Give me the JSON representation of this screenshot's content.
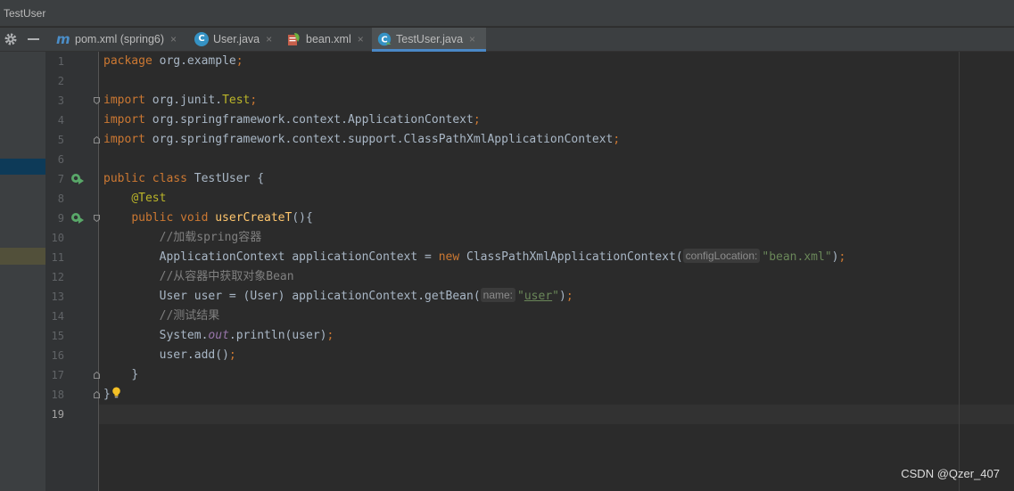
{
  "window": {
    "title": "TestUser"
  },
  "tabs": [
    {
      "label": "pom.xml (spring6)",
      "icon": "maven-m-icon",
      "active": false
    },
    {
      "label": "User.java",
      "icon": "java-class-icon",
      "active": false
    },
    {
      "label": "bean.xml",
      "icon": "spring-xml-icon",
      "active": false
    },
    {
      "label": "TestUser.java",
      "icon": "java-test-class-icon",
      "active": true
    }
  ],
  "tab_close_glyph": "×",
  "toolbar": {
    "settings_icon": "gear-icon",
    "hide_icon": "minus-icon"
  },
  "editor": {
    "line_numbers": [
      "1",
      "2",
      "3",
      "4",
      "5",
      "6",
      "7",
      "8",
      "9",
      "10",
      "11",
      "12",
      "13",
      "14",
      "15",
      "16",
      "17",
      "18",
      "19"
    ],
    "current_line": "19",
    "code": {
      "l1": {
        "kw": "package",
        "rest": " org.example",
        "semi": ";"
      },
      "l3": {
        "kw": "import",
        "pkg": " org.junit.",
        "cls": "Test",
        "semi": ";"
      },
      "l4": {
        "kw": "import",
        "rest": " org.springframework.context.ApplicationContext",
        "semi": ";"
      },
      "l5": {
        "kw": "import",
        "rest": " org.springframework.context.support.ClassPathXmlApplicationContext",
        "semi": ";"
      },
      "l7": {
        "kw": "public class",
        "rest": " TestUser {"
      },
      "l8": {
        "ann": "@Test"
      },
      "l9": {
        "kw": "public void",
        "fn": "userCreateT",
        "rest": "(){"
      },
      "l10": {
        "cmt": "//加载spring容器"
      },
      "l11": {
        "pre": "ApplicationContext applicationContext = ",
        "kw": "new",
        "post": " ClassPathXmlApplicationContext(",
        "hint": "configLocation:",
        "str": "\"bean.xml\"",
        "end": ")",
        "semi": ";"
      },
      "l12": {
        "cmt": "//从容器中获取对象Bean"
      },
      "l13": {
        "pre": "User user = (User) applicationContext.getBean(",
        "hint": "name:",
        "q1": "\"",
        "str": "user",
        "q2": "\"",
        "end": ")",
        "semi": ";"
      },
      "l14": {
        "cmt": "//测试结果"
      },
      "l15": {
        "pre": "System.",
        "fld": "out",
        "post": ".println(user)",
        "semi": ";"
      },
      "l16": {
        "pre": "user.add()",
        "semi": ";"
      },
      "l17": {
        "rest": "}"
      },
      "l18": {
        "rest": "}"
      }
    }
  },
  "watermark": "CSDN @Qzer_407",
  "colors": {
    "keyword": "#cc7832",
    "string": "#6a8759",
    "comment": "#808080",
    "annotation": "#bbb529",
    "method": "#ffc66d",
    "field": "#9876aa",
    "accent": "#4a88c7"
  }
}
